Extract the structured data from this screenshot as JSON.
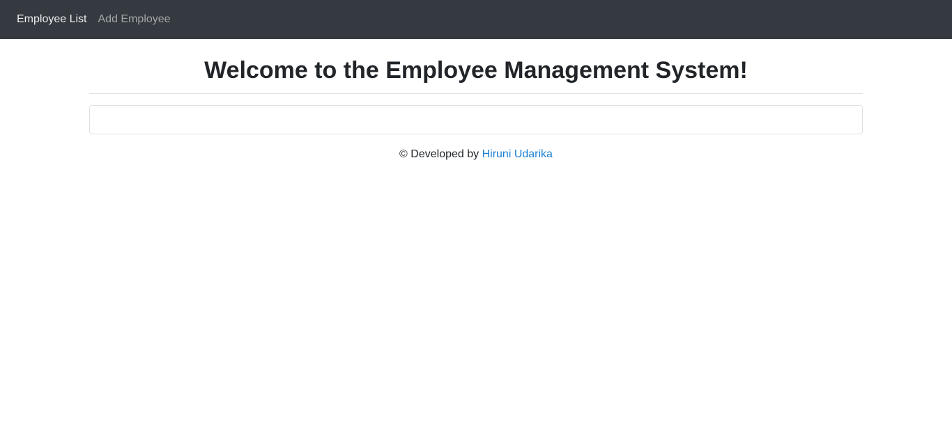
{
  "navbar": {
    "items": [
      {
        "label": "Employee List",
        "active": true
      },
      {
        "label": "Add Employee",
        "active": false
      }
    ],
    "background": "#343a40"
  },
  "main": {
    "title": "Welcome to the Employee Management System!"
  },
  "footer": {
    "copyright_symbol": "©",
    "developed_by_text": "Developed by",
    "developer_name": "Hiruni Udarika",
    "link_color": "#1a7fd4"
  }
}
